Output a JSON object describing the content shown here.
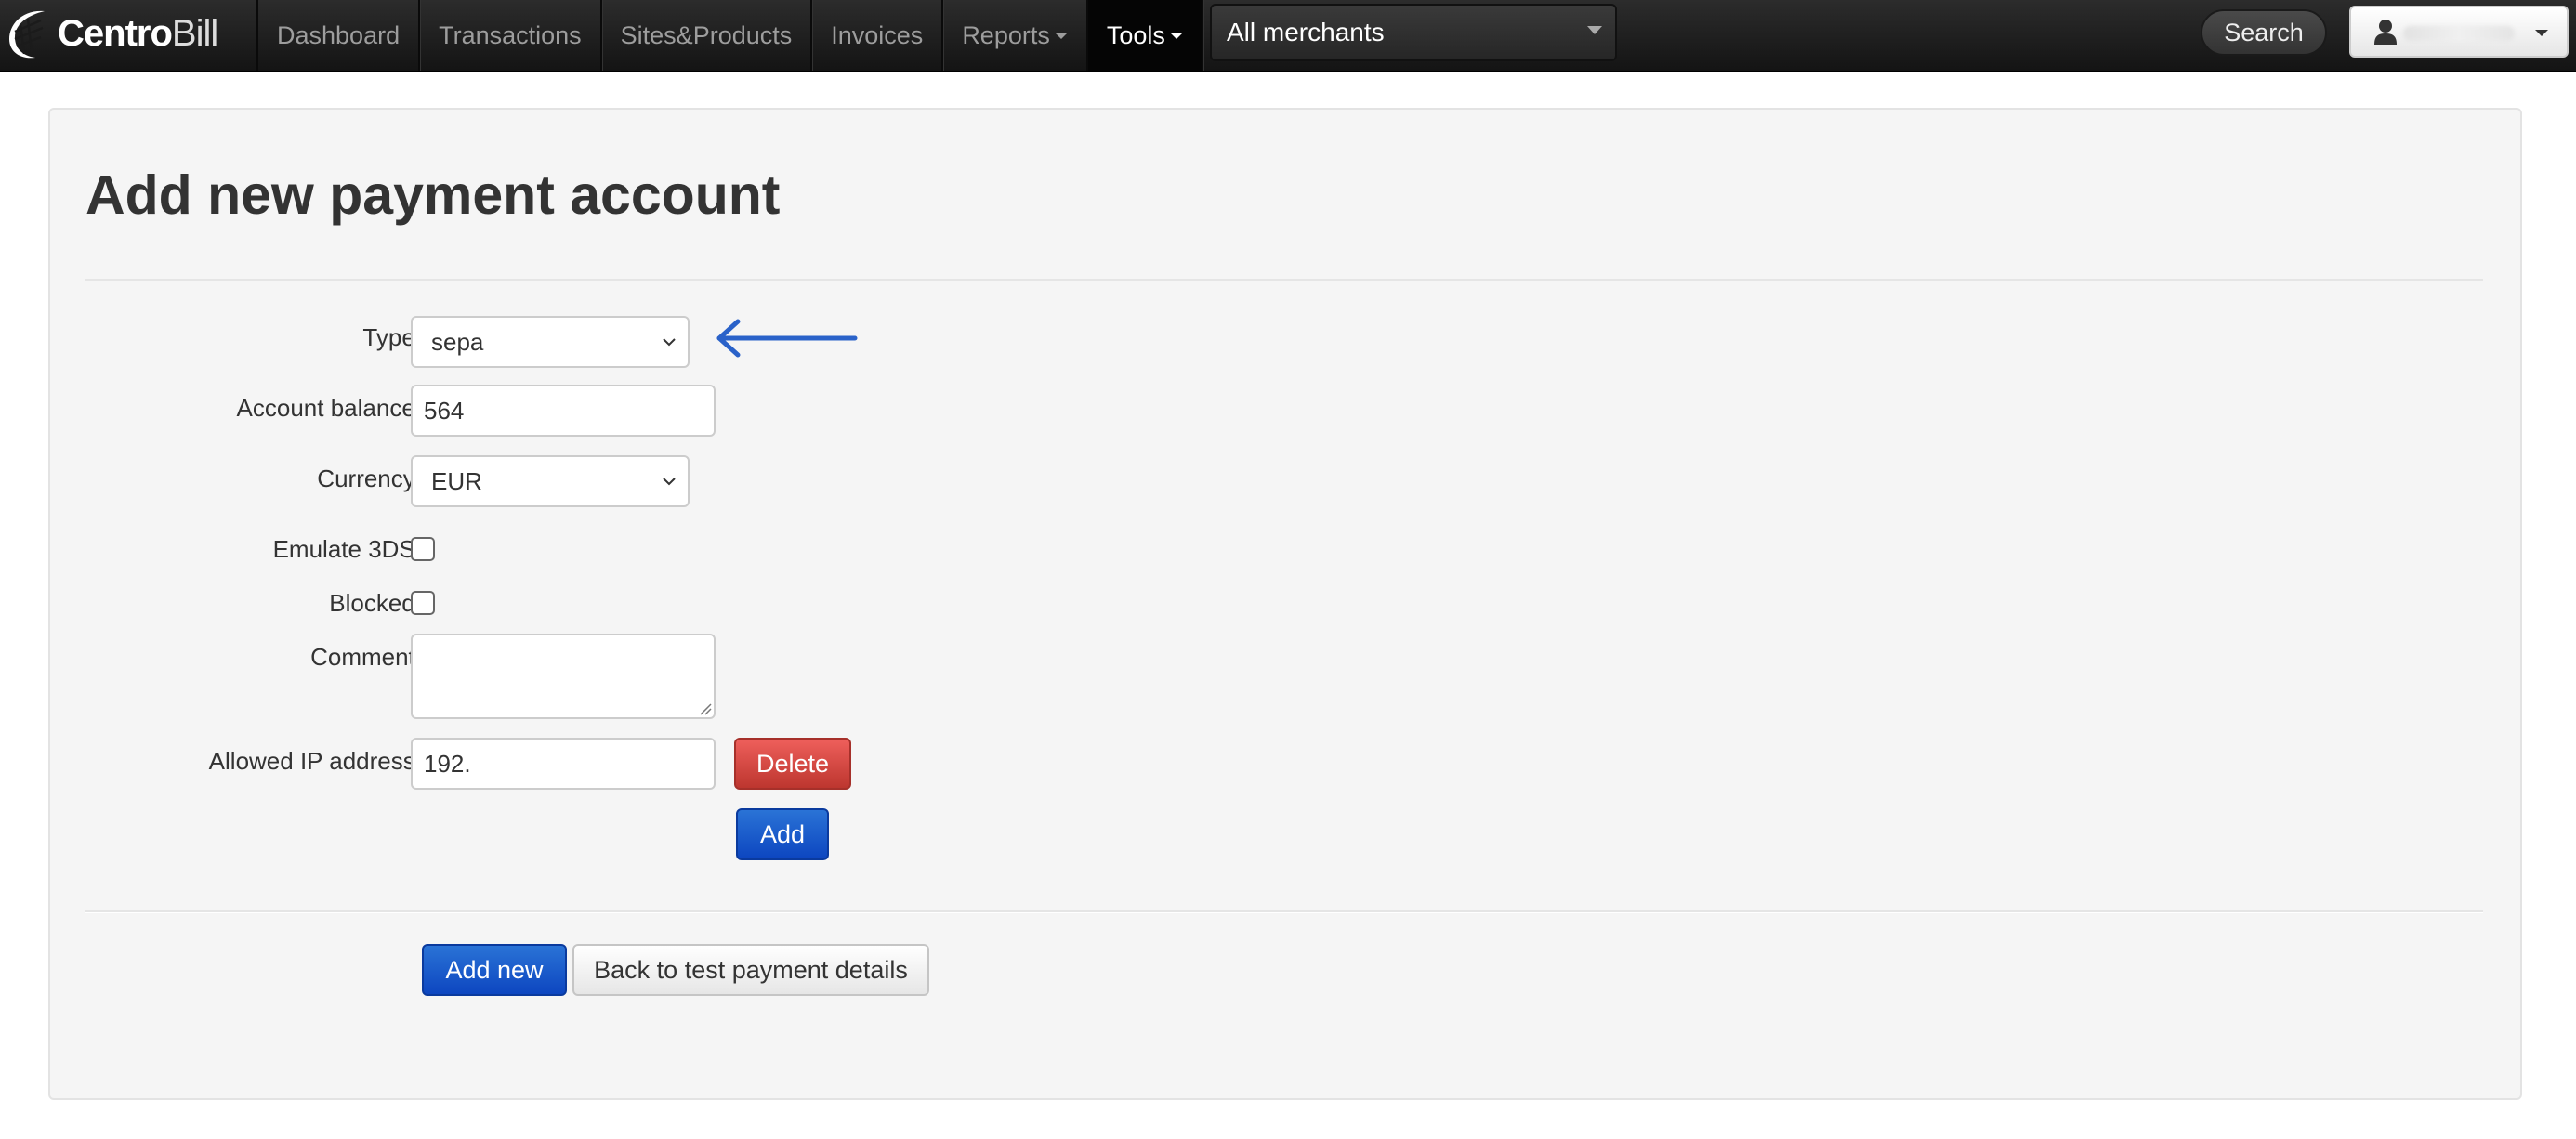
{
  "navbar": {
    "brand_bold": "Centro",
    "brand_light": "Bill",
    "items": [
      {
        "label": "Dashboard",
        "has_caret": false
      },
      {
        "label": "Transactions",
        "has_caret": false
      },
      {
        "label": "Sites&Products",
        "has_caret": false
      },
      {
        "label": "Invoices",
        "has_caret": false
      },
      {
        "label": "Reports",
        "has_caret": true
      },
      {
        "label": "Tools",
        "has_caret": true,
        "active": true
      }
    ],
    "merchant_select": "All merchants",
    "search_label": "Search",
    "user_icon": "user-icon"
  },
  "page": {
    "title": "Add new payment account"
  },
  "form": {
    "type_label": "Type:",
    "type_value": "sepa",
    "balance_label": "Account balance:",
    "balance_value": "564",
    "currency_label": "Currency:",
    "currency_value": "EUR",
    "emulate3ds_label": "Emulate 3DS:",
    "emulate3ds_checked": false,
    "blocked_label": "Blocked:",
    "blocked_checked": false,
    "comment_label": "Comment:",
    "comment_value": "",
    "ip_label": "Allowed IP address:",
    "ip_value": "192.",
    "delete_label": "Delete",
    "add_label": "Add"
  },
  "actions": {
    "add_new_label": "Add new",
    "back_label": "Back to test payment details"
  },
  "colors": {
    "navbar_bg": "#1b1b1b",
    "panel_bg": "#f5f5f5",
    "primary": "#0d46c0",
    "danger": "#bd362f",
    "annotation_arrow": "#2a62c9"
  }
}
